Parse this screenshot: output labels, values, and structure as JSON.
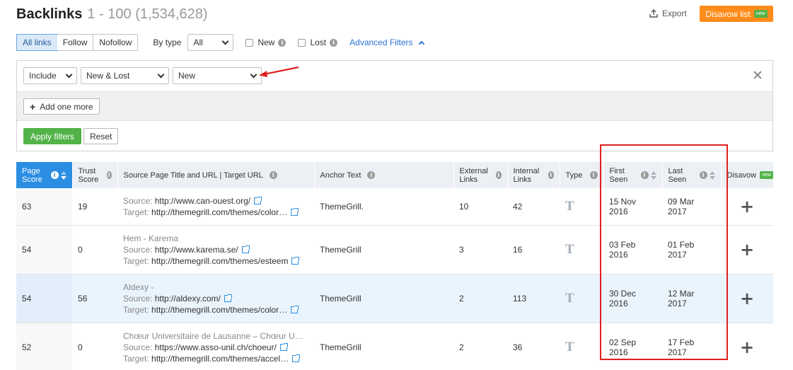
{
  "header": {
    "title": "Backlinks",
    "range": "1 - 100 (1,534,628)",
    "export_label": "Export",
    "disavow_label": "Disavow list",
    "disavow_badge": "new"
  },
  "filters": {
    "link_tabs": [
      {
        "label": "All links",
        "active": true
      },
      {
        "label": "Follow",
        "active": false
      },
      {
        "label": "Nofollow",
        "active": false
      }
    ],
    "by_type_label": "By type",
    "by_type_value": "All",
    "new_label": "New",
    "lost_label": "Lost",
    "advanced_label": "Advanced Filters"
  },
  "advanced": {
    "include_value": "Include",
    "field_value": "New & Lost",
    "condition_value": "New",
    "add_more_label": "Add one more",
    "apply_label": "Apply filters",
    "reset_label": "Reset"
  },
  "table": {
    "columns": {
      "page_score": "Page Score",
      "trust_score": "Trust Score",
      "source": "Source Page Title and URL | Target URL",
      "anchor": "Anchor Text",
      "external": "External Links",
      "internal": "Internal Links",
      "type": "Type",
      "first_seen": "First Seen",
      "last_seen": "Last Seen",
      "disavow": "Disavow",
      "disavow_badge": "new"
    },
    "source_label": "Source:",
    "target_label": "Target:",
    "type_glyph": "T",
    "plus_glyph": "+",
    "rows": [
      {
        "page_score": "63",
        "trust_score": "19",
        "title": "",
        "source": "http://www.can-ouest.org/",
        "target": "http://themegrill.com/themes/color…",
        "anchor": "ThemeGrill.",
        "external": "10",
        "internal": "42",
        "first_seen": "15 Nov 2016",
        "last_seen": "09 Mar 2017",
        "highlight": false
      },
      {
        "page_score": "54",
        "trust_score": "0",
        "title": "Hem - Karema",
        "source": "http://www.karema.se/",
        "target": "http://themegrill.com/themes/esteem",
        "anchor": "ThemeGrill",
        "external": "3",
        "internal": "16",
        "first_seen": "03 Feb 2016",
        "last_seen": "01 Feb 2017",
        "highlight": false
      },
      {
        "page_score": "54",
        "trust_score": "56",
        "title": "Aldexy -",
        "source": "http://aldexy.com/",
        "target": "http://themegrill.com/themes/color…",
        "anchor": "ThemeGrill",
        "external": "2",
        "internal": "113",
        "first_seen": "30 Dec 2016",
        "last_seen": "12 Mar 2017",
        "highlight": true
      },
      {
        "page_score": "52",
        "trust_score": "0",
        "title": "Chœur Universitaire de Lausanne – Chœur UNI…",
        "source": "https://www.asso-unil.ch/choeur/",
        "target": "http://themegrill.com/themes/accel…",
        "anchor": "ThemeGrill",
        "external": "2",
        "internal": "36",
        "first_seen": "02 Sep 2016",
        "last_seen": "17 Feb 2017",
        "highlight": false
      }
    ]
  },
  "colors": {
    "accent_orange": "#ff8c1a",
    "accent_green": "#52b348",
    "accent_blue": "#2b8ee3",
    "annotation_red": "#e02020"
  }
}
